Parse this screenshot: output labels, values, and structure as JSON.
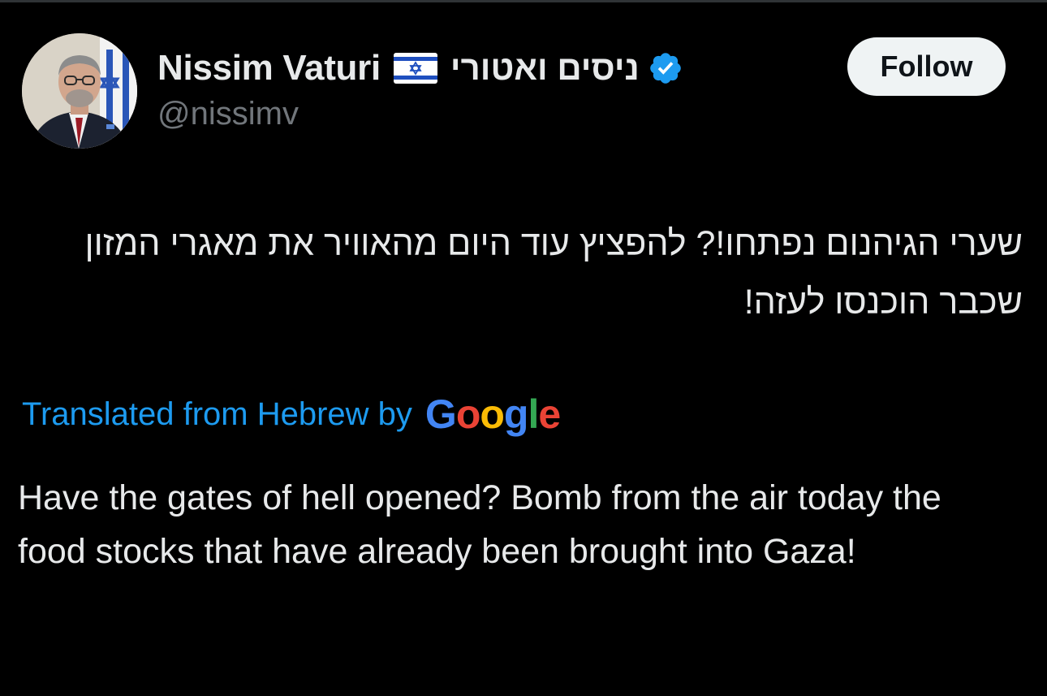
{
  "author": {
    "display_name": "Nissim Vaturi",
    "flag_icon": "israel-flag-icon",
    "hebrew_name": "ניסים ואטורי",
    "verified_icon": "verified-badge-icon",
    "handle": "@nissimv"
  },
  "follow_button": {
    "label": "Follow"
  },
  "post": {
    "hebrew_text": "שערי הגיהנום נפתחו!? להפציץ עוד היום מהאוויר את מאגרי המזון שכבר הוכנסו לעזה!",
    "translated_label": "Translated from Hebrew by",
    "google_logo": [
      "G",
      "o",
      "o",
      "g",
      "l",
      "e"
    ],
    "translation": "Have the gates of hell opened? Bomb from the air today the food stocks that have already been brought into Gaza!"
  },
  "colors": {
    "background": "#000000",
    "text": "#e7e9ea",
    "muted": "#71767b",
    "accent": "#1d9bf0",
    "google_blue": "#4285F4",
    "google_red": "#EA4335",
    "google_yellow": "#FBBC05",
    "google_green": "#34A853"
  }
}
